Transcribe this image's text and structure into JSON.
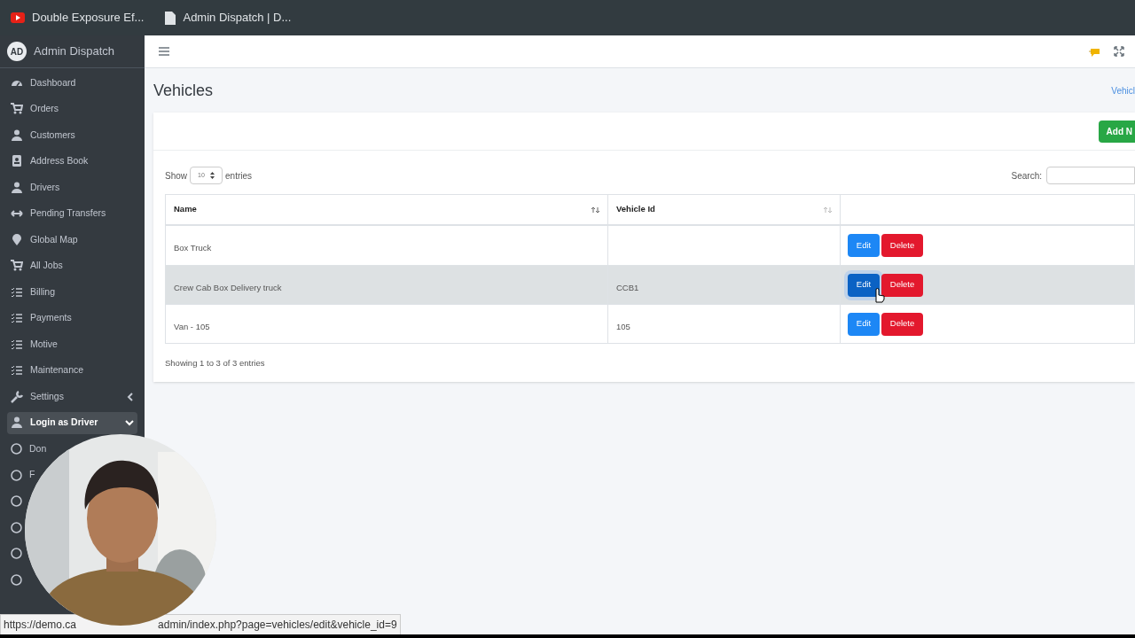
{
  "browser_tabs": [
    {
      "title": "Double Exposure Ef...",
      "kind": "video"
    },
    {
      "title": "Admin Dispatch | D...",
      "kind": "page"
    }
  ],
  "brand": {
    "initials": "AD",
    "name": "Admin Dispatch"
  },
  "sidebar": {
    "items": [
      {
        "label": "Dashboard",
        "selected": false
      },
      {
        "label": "Orders",
        "selected": false
      },
      {
        "label": "Customers",
        "selected": false
      },
      {
        "label": "Address Book",
        "selected": false
      },
      {
        "label": "Drivers",
        "selected": false
      },
      {
        "label": "Pending Transfers",
        "selected": false
      },
      {
        "label": "Global Map",
        "selected": false
      },
      {
        "label": "All Jobs",
        "selected": false
      },
      {
        "label": "Billing",
        "selected": false
      },
      {
        "label": "Payments",
        "selected": false
      },
      {
        "label": "Motive",
        "selected": false
      },
      {
        "label": "Maintenance",
        "selected": false
      },
      {
        "label": "Settings",
        "selected": false,
        "expanded": false
      },
      {
        "label": "Login as Driver",
        "selected": true,
        "expanded": true,
        "children": [
          {
            "kind": "radio",
            "label": "Don"
          },
          {
            "kind": "radio",
            "label": "F"
          },
          {
            "kind": "radio"
          },
          {
            "kind": "radio"
          },
          {
            "kind": "radio"
          },
          {
            "kind": "radio"
          }
        ]
      }
    ]
  },
  "page_title": "Vehicles",
  "breadcrumb": "Vehicl",
  "add_button": "Add N",
  "length": {
    "before": "Show",
    "value": "10",
    "after": "entries"
  },
  "search": {
    "label": "Search:"
  },
  "table": {
    "columns": [
      "Name",
      "Vehicle Id"
    ],
    "rows": [
      {
        "cells": [
          "Box Truck",
          ""
        ],
        "selected": false,
        "actions": [
          "Edit",
          "Delete"
        ]
      },
      {
        "cells": [
          "Crew Cab Box Delivery truck",
          "CCB1"
        ],
        "selected": true,
        "actions": [
          "Edit",
          "Delete"
        ]
      },
      {
        "cells": [
          "Van - 105",
          "105"
        ],
        "selected": false,
        "actions": [
          "Edit",
          "Delete"
        ]
      }
    ]
  },
  "info": "Showing 1 to 3 of 3 entries",
  "status_url": "https://demo.ca",
  "status_url_end": "admin/index.php?page=vehicles/edit&vehicle_id=9"
}
